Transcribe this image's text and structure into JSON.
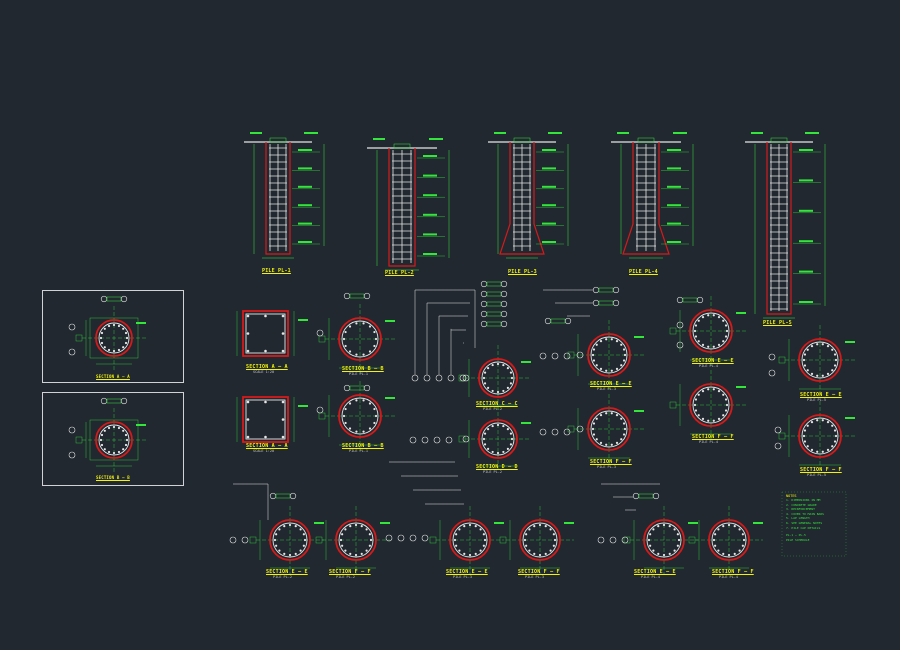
{
  "colors": {
    "background": "#212830",
    "outline_red": "#d61a1a",
    "rebar_white": "#e6e6e6",
    "dim_green": "#34e63c",
    "text_yellow": "#f2f20a",
    "panel_border": "#cfd3d6"
  },
  "piles": [
    {
      "label": "PILE PL-1"
    },
    {
      "label": "PILE PL-2"
    },
    {
      "label": "PILE PL-3"
    },
    {
      "label": "PILE PL-4"
    },
    {
      "label": "PILE PL-5"
    }
  ],
  "sections": {
    "s1": {
      "title": "SECTION A — A",
      "sub": "SCALE 1:20"
    },
    "s2": {
      "title": "SECTION B — B",
      "sub": "PILE PL-1"
    },
    "s3": {
      "title": "SECTION A — A",
      "sub": "SCALE 1:20"
    },
    "s4": {
      "title": "SECTION B — B",
      "sub": "PILE PL-1"
    },
    "s5": {
      "title": "SECTION C — C",
      "sub": "PILE PL-2"
    },
    "s6": {
      "title": "SECTION D — D",
      "sub": "PILE PL-2"
    },
    "s7": {
      "title": "SECTION E — E",
      "sub": "PILE PL-3"
    },
    "s8": {
      "title": "SECTION F — F",
      "sub": "PILE PL-3"
    },
    "s9": {
      "title": "SECTION E — E",
      "sub": "PILE PL-4"
    },
    "s10": {
      "title": "SECTION F — F",
      "sub": "PILE PL-4"
    },
    "s11": {
      "title": "SECTION E — E",
      "sub": "PILE PL-5"
    },
    "s12": {
      "title": "SECTION F — F",
      "sub": "PILE PL-5"
    },
    "s13": {
      "title": "SECTION E — E",
      "sub": "PILE PL-2"
    },
    "s14": {
      "title": "SECTION F — F",
      "sub": "PILE PL-2"
    },
    "s15": {
      "title": "SECTION E — E",
      "sub": "PILE PL-3"
    },
    "s16": {
      "title": "SECTION F — F",
      "sub": "PILE PL-3"
    },
    "s17": {
      "title": "SECTION E — E",
      "sub": "PILE PL-4"
    },
    "s18": {
      "title": "SECTION F — F",
      "sub": "PILE PL-4"
    }
  },
  "panels": {
    "p1": {
      "title": "SECTION A — A"
    },
    "p2": {
      "title": "SECTION B — B"
    }
  },
  "notes": {
    "title": "NOTES",
    "lines": [
      "1. DIMENSIONS IN MM",
      "2. CONCRETE GRADE",
      "3. REINFORCEMENT",
      "4. COVER TO MAIN BARS",
      "5. LAP LENGTH",
      "6. SEE GENERAL NOTES",
      "7. PILE CAP DETAILS"
    ],
    "footer": [
      "PL-1 ~ PL-5",
      "PILE SCHEDULE"
    ]
  }
}
